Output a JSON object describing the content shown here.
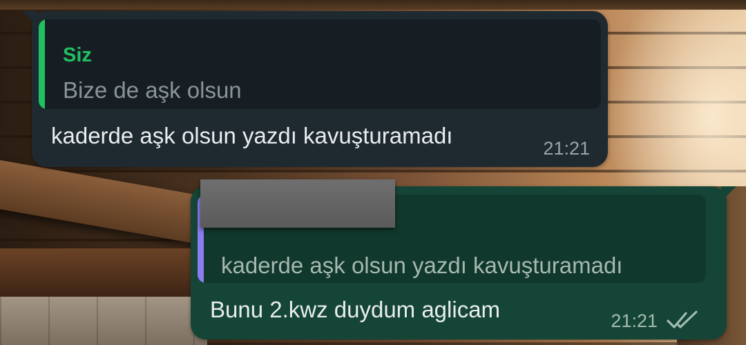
{
  "incoming": {
    "quoted_sender": "Siz",
    "quoted_text": "Bize de aşk olsun",
    "text": "kaderde aşk olsun yazdı kavuşturamadı",
    "time": "21:21"
  },
  "outgoing": {
    "quoted_text": "kaderde aşk olsun yazdı kavuşturamadı",
    "text": "Bunu 2.kwz duydum aglicam",
    "time": "21:21",
    "status_icon": "double-check-icon"
  },
  "colors": {
    "incoming_bubble": "#1f2a30",
    "outgoing_bubble": "#154536",
    "accent_green": "#21c063",
    "quote_bar_purple": "#8b7cf0"
  }
}
